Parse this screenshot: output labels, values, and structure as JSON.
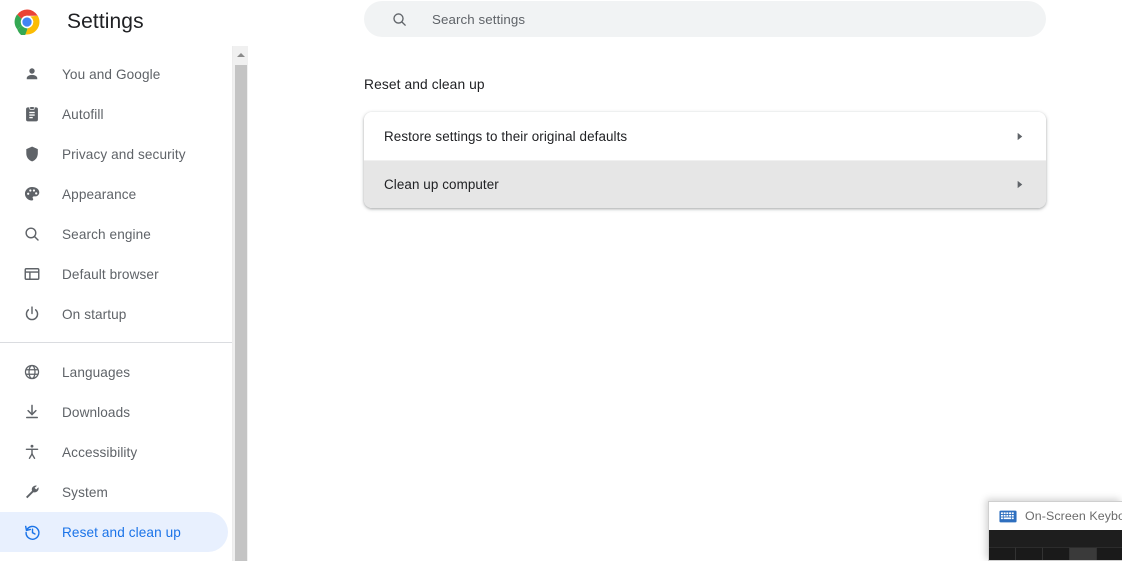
{
  "app": {
    "title": "Settings",
    "logo_icon": "chrome-logo"
  },
  "sidebar": {
    "groups": [
      {
        "items": [
          {
            "label": "You and Google",
            "icon": "person-icon",
            "selected": false
          },
          {
            "label": "Autofill",
            "icon": "clipboard-icon",
            "selected": false
          },
          {
            "label": "Privacy and security",
            "icon": "shield-icon",
            "selected": false
          },
          {
            "label": "Appearance",
            "icon": "palette-icon",
            "selected": false
          },
          {
            "label": "Search engine",
            "icon": "search-icon",
            "selected": false
          },
          {
            "label": "Default browser",
            "icon": "browser-window-icon",
            "selected": false
          },
          {
            "label": "On startup",
            "icon": "power-icon",
            "selected": false
          }
        ]
      },
      {
        "items": [
          {
            "label": "Languages",
            "icon": "globe-icon",
            "selected": false
          },
          {
            "label": "Downloads",
            "icon": "download-icon",
            "selected": false
          },
          {
            "label": "Accessibility",
            "icon": "accessibility-icon",
            "selected": false
          },
          {
            "label": "System",
            "icon": "wrench-icon",
            "selected": false
          },
          {
            "label": "Reset and clean up",
            "icon": "history-restore-icon",
            "selected": true
          }
        ]
      }
    ],
    "selected_bg": "#e8f0fe",
    "selected_fg": "#1a73e8"
  },
  "search": {
    "placeholder": "Search settings",
    "value": "",
    "icon": "search-icon"
  },
  "main": {
    "section_heading": "Reset and clean up",
    "rows": [
      {
        "label": "Restore settings to their original defaults",
        "arrow_icon": "chevron-right-icon",
        "highlighted": false
      },
      {
        "label": "Clean up computer",
        "arrow_icon": "chevron-right-icon",
        "highlighted": true
      }
    ]
  },
  "osk": {
    "title": "On-Screen Keyboard",
    "icon": "keyboard-icon"
  },
  "colors": {
    "accent": "#1a73e8",
    "text_primary": "#202124",
    "text_secondary": "#5f6368",
    "search_bg": "#f1f3f4",
    "row_highlight": "#e6e6e6",
    "divider": "#dadce0"
  }
}
